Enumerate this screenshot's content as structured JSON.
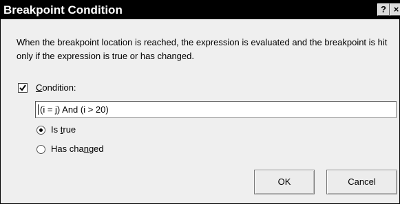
{
  "dialog": {
    "title": "Breakpoint Condition",
    "help_glyph": "?",
    "close_glyph": "×",
    "description": "When the breakpoint location is reached, the expression is evaluated and the breakpoint is hit only if the expression is true or has changed.",
    "condition": {
      "checked": true,
      "label_underlined": "C",
      "label_rest": "ondition:",
      "value": "(i = j) And (i > 20)"
    },
    "options": {
      "is_true": {
        "label_before": "Is ",
        "label_underlined": "t",
        "label_after": "rue",
        "selected": true
      },
      "has_changed": {
        "label_before": "Has cha",
        "label_underlined": "n",
        "label_after": "ged",
        "selected": false
      }
    },
    "buttons": {
      "ok": "OK",
      "cancel": "Cancel"
    }
  },
  "icons": {
    "help": "help-icon",
    "close": "close-icon",
    "checkbox": "checkmark-icon",
    "radio": "radio-dot-icon"
  }
}
